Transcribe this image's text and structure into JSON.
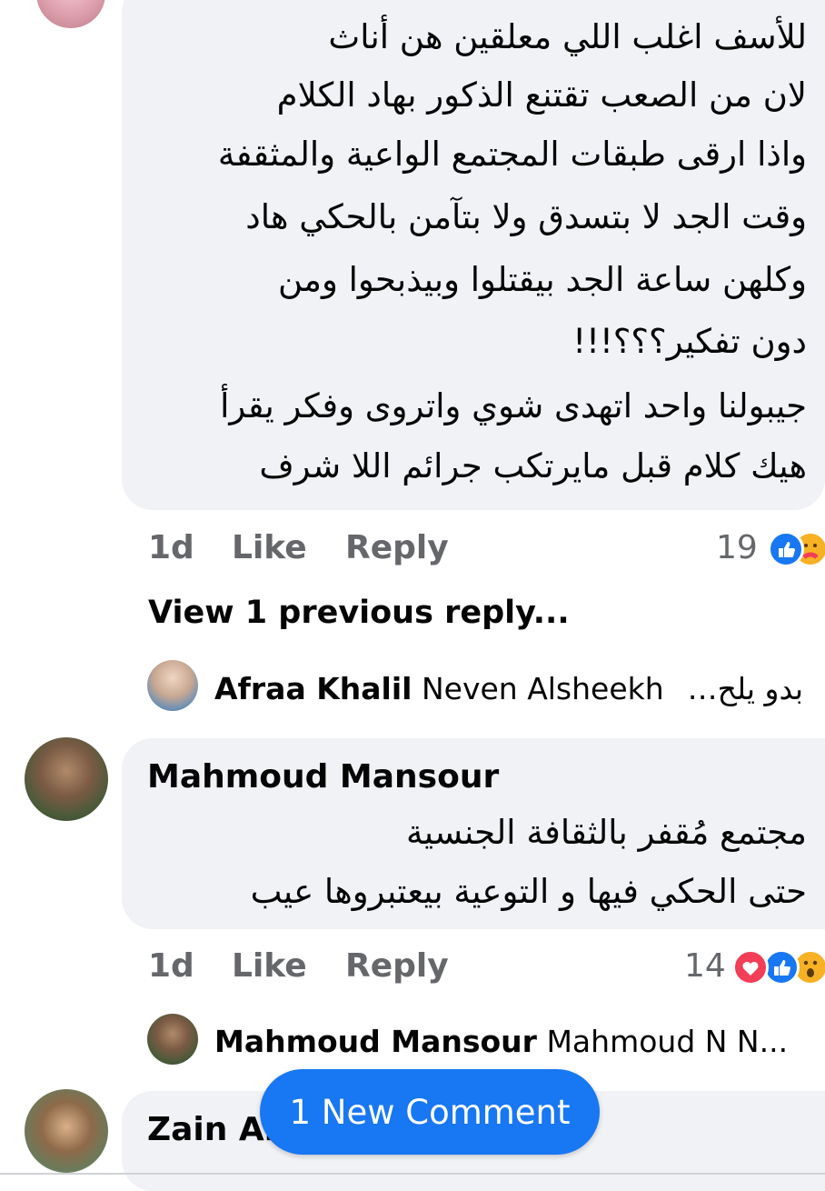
{
  "comment1": {
    "lines": [
      "للأسف اغلب اللي معلقين هن أناث",
      "لان من الصعب تقتنع الذكور بهاد الكلام",
      "واذا ارقى طبقات المجتمع الواعية والمثقفة",
      "وقت الجد لا بتسدق ولا بتآمن بالحكي هاد",
      "وكلهن ساعة الجد بيقتلوا وبيذبحوا ومن",
      "دون تفكير؟؟؟!!!",
      "جيبولنا واحد اتهدى شوي واتروى وفكر يقرأ",
      "هيك كلام قبل مايرتكب جرائم اللا شرف"
    ],
    "time": "1d",
    "like": "Like",
    "reply": "Reply",
    "reactions_count": "19",
    "reaction_icons": [
      "like-icon",
      "care-icon"
    ]
  },
  "view_previous": "View 1 previous reply...",
  "reply_preview1": {
    "name": "Afraa Khalil",
    "tag": "Neven Alsheekh",
    "snippet": "بدو يلح…"
  },
  "comment2": {
    "author": "Mahmoud Mansour",
    "lines": [
      "مجتمع مُقفر بالثقافة الجنسية",
      "حتى الحكي فيها و التوعية بيعتبروها عيب"
    ],
    "time": "1d",
    "like": "Like",
    "reply": "Reply",
    "reactions_count": "14",
    "reaction_icons": [
      "love-icon",
      "like-icon",
      "wow-icon"
    ]
  },
  "reply_preview2": {
    "name": "Mahmoud Mansour",
    "tag": "Mahmoud N N..."
  },
  "comment3": {
    "author": "Zain Al"
  },
  "new_comment_pill": "1 New Comment",
  "colors": {
    "bubble": "#f0f2f5",
    "meta": "#65676b",
    "fb_blue": "#1877f2",
    "love_red": "#f33e58",
    "wow_yellow": "#f7b125"
  }
}
